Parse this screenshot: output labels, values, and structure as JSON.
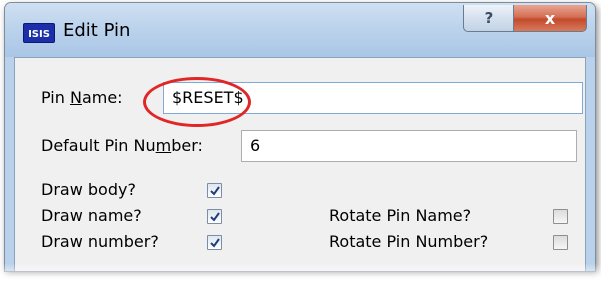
{
  "window": {
    "app_icon_text": "ISIS",
    "title": "Edit Pin",
    "help_glyph": "?",
    "close_glyph": "x"
  },
  "form": {
    "pin_name_label_before": "Pin ",
    "pin_name_label_accel": "N",
    "pin_name_label_after": "ame:",
    "pin_name_value": "$RESET$",
    "default_pin_number_label_before": "Default Pin Nu",
    "default_pin_number_label_accel": "m",
    "default_pin_number_label_after": "ber:",
    "default_pin_number_value": "6",
    "checkboxes": {
      "draw_body": {
        "label": "Draw body?",
        "checked": true
      },
      "draw_name": {
        "label": "Draw name?",
        "checked": true
      },
      "draw_number": {
        "label": "Draw number?",
        "checked": true
      },
      "rotate_pin_name": {
        "label": "Rotate Pin Name?",
        "checked": false
      },
      "rotate_pin_number": {
        "label": "Rotate Pin Number?",
        "checked": false
      }
    }
  },
  "colors": {
    "highlight_ellipse": "#e02626",
    "check_mark": "#1f3f7a"
  },
  "icons": {
    "app": "isis-app-icon",
    "help": "help-icon",
    "close": "close-icon",
    "check": "checkmark-icon"
  }
}
